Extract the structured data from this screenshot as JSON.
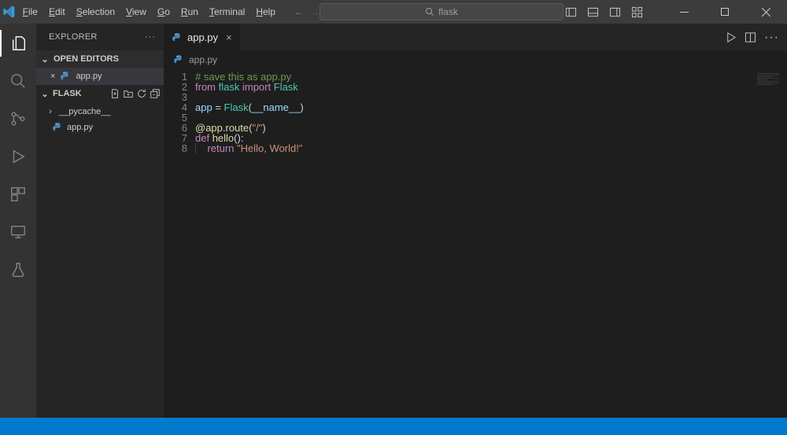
{
  "title_menu": [
    "File",
    "Edit",
    "Selection",
    "View",
    "Go",
    "Run",
    "Terminal",
    "Help"
  ],
  "search": {
    "placeholder": "flask"
  },
  "sidebar": {
    "title": "EXPLORER",
    "open_editors_label": "OPEN EDITORS",
    "open_editor_file": "app.py",
    "project_label": "FLASK",
    "tree": {
      "folder1": "__pycache__",
      "file1": "app.py"
    }
  },
  "tabs": {
    "active": "app.py"
  },
  "breadcrumb": {
    "file": "app.py"
  },
  "code": {
    "lines": [
      "1",
      "2",
      "3",
      "4",
      "5",
      "6",
      "7",
      "8"
    ],
    "l1_comment": "# save this as app.py",
    "l2_from": "from",
    "l2_mod": "flask",
    "l2_import": "import",
    "l2_cls": "Flask",
    "l4_var": "app",
    "l4_eq": " = ",
    "l4_cls": "Flask",
    "l4_open": "(",
    "l4_name": "__name__",
    "l4_close": ")",
    "l6_dec": "@app.route",
    "l6_args": "(",
    "l6_path": "\"/\"",
    "l6_close": ")",
    "l7_def": "def",
    "l7_fn": " hello",
    "l7_sig": "():",
    "l8_indent": "    ",
    "l8_ret": "return",
    "l8_sp": " ",
    "l8_str": "\"Hello, World!\""
  }
}
